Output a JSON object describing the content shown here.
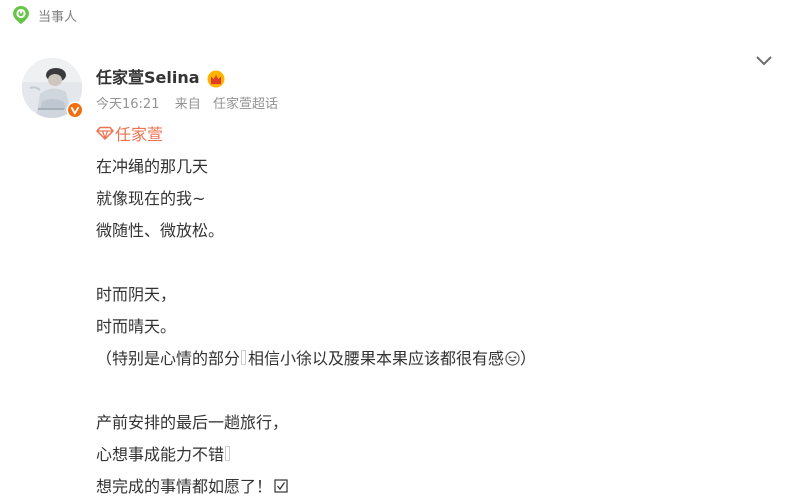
{
  "tag": {
    "label": "当事人",
    "icon": "location-pin-icon"
  },
  "post": {
    "author": {
      "name": "任家萱Selina",
      "verified": true,
      "member_badge": "crown-icon"
    },
    "meta": {
      "time": "今天16:21",
      "from_prefix": "来自",
      "source": "任家萱超话"
    },
    "topic": {
      "label": "任家萱",
      "icon": "diamond-icon"
    },
    "body": {
      "line1": "在冲绳的那几天",
      "line2": "就像现在的我~",
      "line3": "微随性、微放松。",
      "line4": "时而阴天，",
      "line5": "时而晴天。",
      "line6a": "（特别是心情的部分",
      "line6b": "相信小徐以及腰果本果应该都很有感",
      "line6c": "）",
      "line7": "产前安排的最后一趟旅行，",
      "line8": "心想事成能力不错",
      "line9": "想完成的事情都如愿了！"
    }
  },
  "colors": {
    "accent": "#eb7350",
    "verified": "#f26d0f",
    "tag_green": "#66c447",
    "meta_gray": "#939393"
  }
}
